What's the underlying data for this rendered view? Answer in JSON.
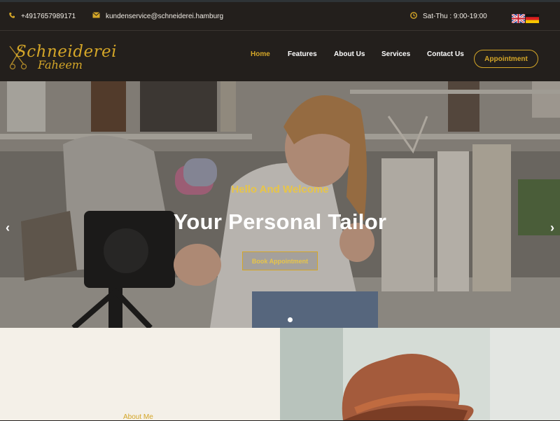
{
  "topbar": {
    "phone": "+4917657989171",
    "email": "kundenservice@schneiderei.hamburg",
    "hours": "Sat-Thu : 9:00-19:00",
    "phone_icon": "phone-icon",
    "email_icon": "envelope-icon",
    "clock_icon": "clock-icon",
    "languages": [
      "English",
      "Deutsch"
    ]
  },
  "brand": {
    "line1": "Schneiderei",
    "line2": "Faheem"
  },
  "nav": {
    "items": [
      {
        "label": "Home",
        "active": true
      },
      {
        "label": "Features",
        "active": false
      },
      {
        "label": "About Us",
        "active": false
      },
      {
        "label": "Services",
        "active": false
      },
      {
        "label": "Contact Us",
        "active": false
      }
    ],
    "cta": "Appointment"
  },
  "hero": {
    "subtitle": "Hello And Welcome",
    "title": "Your Personal Tailor",
    "button": "Book Appointment",
    "prev_icon": "chevron-left-icon",
    "next_icon": "chevron-right-icon",
    "slide_count": 1,
    "active_slide": 1
  },
  "about": {
    "label": "About Me"
  },
  "colors": {
    "accent": "#d4a628",
    "header_bg": "#231f1c",
    "about_bg": "#f4f0e8"
  }
}
